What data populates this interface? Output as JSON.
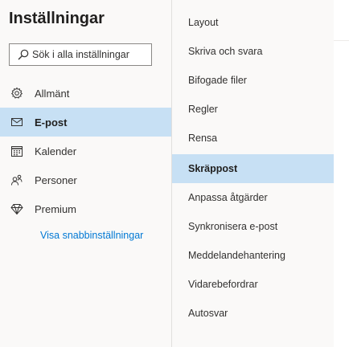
{
  "settings": {
    "title": "Inställningar",
    "search": {
      "placeholder": "Sök i alla inställningar",
      "value": ""
    },
    "nav": [
      {
        "label": "Allmänt",
        "icon": "gear-icon"
      },
      {
        "label": "E-post",
        "icon": "mail-icon",
        "selected": true
      },
      {
        "label": "Kalender",
        "icon": "calendar-icon"
      },
      {
        "label": "Personer",
        "icon": "people-icon"
      },
      {
        "label": "Premium",
        "icon": "diamond-icon"
      }
    ],
    "quick_settings_link": "Visa snabbinställningar"
  },
  "mail_settings": {
    "items": [
      "Layout",
      "Skriva och svara",
      "Bifogade filer",
      "Regler",
      "Rensa",
      "Skräppost",
      "Anpassa åtgärder",
      "Synkronisera e-post",
      "Meddelandehantering",
      "Vidarebefordrar",
      "Autosvar"
    ],
    "selected": "Skräppost"
  },
  "colors": {
    "selected_bg": "#c7e0f4",
    "link": "#0078d4",
    "pane_bg": "#faf9f8"
  }
}
